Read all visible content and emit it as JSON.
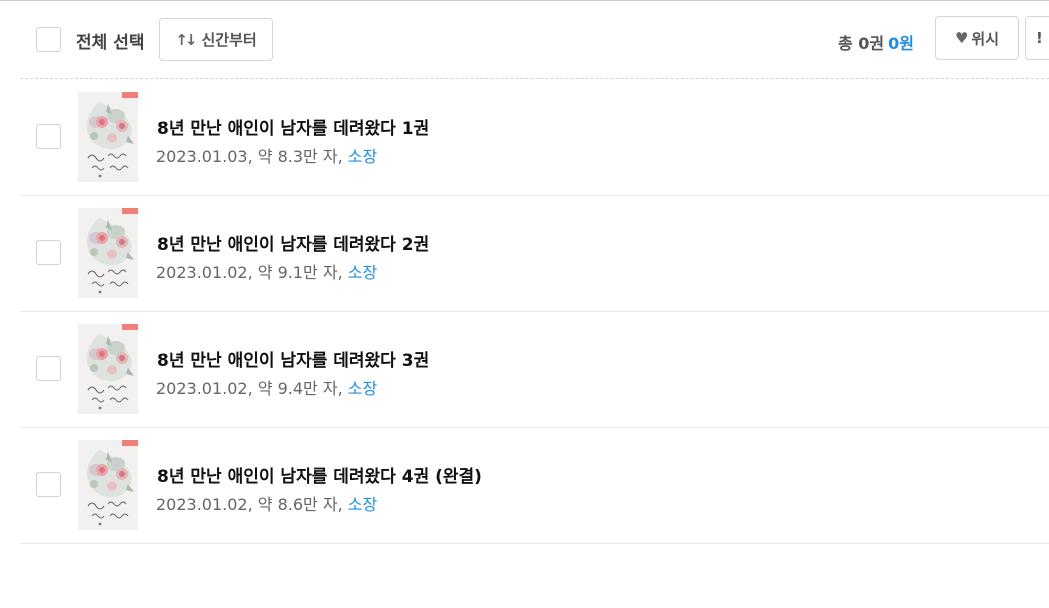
{
  "toolbar": {
    "select_all_label": "전체 선택",
    "sort_icon": "sort-arrows-icon",
    "sort_label": "신간부터",
    "total_label": "총 0권",
    "total_price": "0원",
    "wish_icon": "heart-icon",
    "wish_label": "위시",
    "cut_label": "!"
  },
  "books": [
    {
      "title": "8년 만난 애인이 남자를 데려왔다 1권",
      "date": "2023.01.03",
      "length": "약 8.3만 자",
      "status": "소장"
    },
    {
      "title": "8년 만난 애인이 남자를 데려왔다 2권",
      "date": "2023.01.02",
      "length": "약 9.1만 자",
      "status": "소장"
    },
    {
      "title": "8년 만난 애인이 남자를 데려왔다 3권",
      "date": "2023.01.02",
      "length": "약 9.4만 자",
      "status": "소장"
    },
    {
      "title": "8년 만난 애인이 남자를 데려왔다 4권 (완결)",
      "date": "2023.01.02",
      "length": "약 8.6만 자",
      "status": "소장"
    }
  ],
  "colors": {
    "accent": "#1f8ce6",
    "border": "#d1d5da",
    "text": "#111111",
    "muted": "#666666"
  }
}
